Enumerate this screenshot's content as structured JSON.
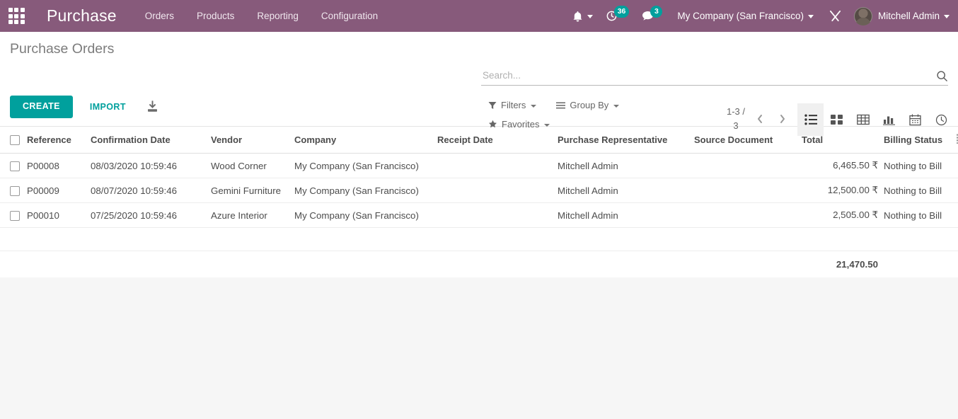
{
  "navbar": {
    "apps_icon": "apps-grid-icon",
    "brand": "Purchase",
    "menu_items": [
      {
        "label": "Orders"
      },
      {
        "label": "Products"
      },
      {
        "label": "Reporting"
      },
      {
        "label": "Configuration"
      }
    ],
    "activity_badge": "36",
    "messages_badge": "3",
    "company": "My Company (San Francisco)",
    "debug_icon": "wrench-screwdriver-icon",
    "user_name": "Mitchell Admin"
  },
  "control_panel": {
    "breadcrumb": "Purchase Orders",
    "create_label": "CREATE",
    "import_label": "IMPORT",
    "export_icon": "download-export-icon",
    "search": {
      "value": "",
      "placeholder": "Search...",
      "icon": "search-magnifier-icon"
    },
    "filters_label": "Filters",
    "group_by_label": "Group By",
    "favorites_label": "Favorites",
    "pager": "1-3 / 3",
    "views": [
      {
        "name": "list",
        "icon": "list-view-icon",
        "active": true
      },
      {
        "name": "kanban",
        "icon": "kanban-view-icon",
        "active": false
      },
      {
        "name": "pivot",
        "icon": "pivot-view-icon",
        "active": false
      },
      {
        "name": "graph",
        "icon": "graph-view-icon",
        "active": false
      },
      {
        "name": "calendar",
        "icon": "calendar-view-icon",
        "active": false
      },
      {
        "name": "activity",
        "icon": "activity-clock-view-icon",
        "active": false
      }
    ]
  },
  "list": {
    "columns": [
      "Reference",
      "Confirmation Date",
      "Vendor",
      "Company",
      "Receipt Date",
      "Purchase Representative",
      "Source Document",
      "Total",
      "Billing Status"
    ],
    "rows": [
      {
        "reference": "P00008",
        "confirmation_date": "08/03/2020 10:59:46",
        "vendor": "Wood Corner",
        "company": "My Company (San Francisco)",
        "receipt_date": "",
        "purchase_representative": "Mitchell Admin",
        "source_document": "",
        "total": "6,465.50 ₹",
        "billing_status": "Nothing to Bill"
      },
      {
        "reference": "P00009",
        "confirmation_date": "08/07/2020 10:59:46",
        "vendor": "Gemini Furniture",
        "company": "My Company (San Francisco)",
        "receipt_date": "",
        "purchase_representative": "Mitchell Admin",
        "source_document": "",
        "total": "12,500.00 ₹",
        "billing_status": "Nothing to Bill"
      },
      {
        "reference": "P00010",
        "confirmation_date": "07/25/2020 10:59:46",
        "vendor": "Azure Interior",
        "company": "My Company (San Francisco)",
        "receipt_date": "",
        "purchase_representative": "Mitchell Admin",
        "source_document": "",
        "total": "2,505.00 ₹",
        "billing_status": "Nothing to Bill"
      }
    ],
    "total_sum": "21,470.50",
    "optional_columns_icon": "optional-columns-toggle-icon"
  },
  "colors": {
    "brand_purple": "#875a7b",
    "accent_teal": "#00a09d",
    "page_background": "#f6f6f6"
  }
}
